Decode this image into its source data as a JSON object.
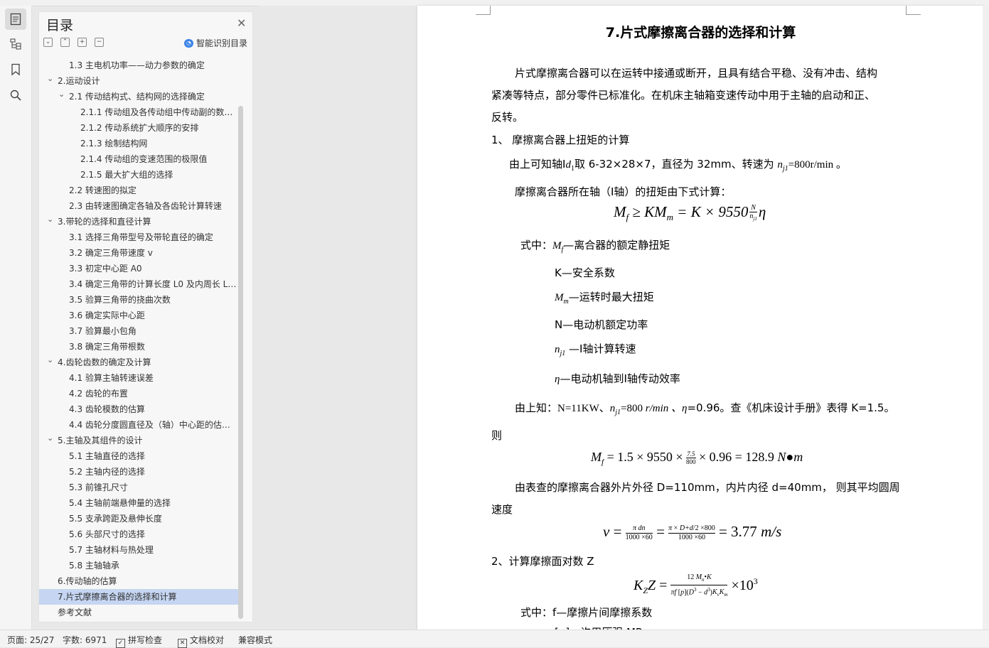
{
  "sidebar": {
    "title": "目录",
    "smart_label": "智能识别目录",
    "toc": [
      {
        "label": "1.3 主电机功率——动力参数的确定",
        "level": 2,
        "chev": ""
      },
      {
        "label": "2.运动设计",
        "level": 1,
        "chev": "v"
      },
      {
        "label": "2.1 传动结构式、结构网的选择确定",
        "level": 2,
        "chev": "v"
      },
      {
        "label": "2.1.1 传动组及各传动组中传动副的数…",
        "level": 3,
        "chev": ""
      },
      {
        "label": "2.1.2  传动系统扩大顺序的安排",
        "level": 3,
        "chev": ""
      },
      {
        "label": "2.1.3  绘制结构网",
        "level": 3,
        "chev": ""
      },
      {
        "label": "2.1.4  传动组的变速范围的极限值",
        "level": 3,
        "chev": ""
      },
      {
        "label": "2.1.5 最大扩大组的选择",
        "level": 3,
        "chev": ""
      },
      {
        "label": "2.2 转速图的拟定",
        "level": 2,
        "chev": ""
      },
      {
        "label": "2.3  由转速图确定各轴及各齿轮计算转速",
        "level": 2,
        "chev": ""
      },
      {
        "label": "3.带轮的选择和直径计算",
        "level": 1,
        "chev": "v"
      },
      {
        "label": "3.1 选择三角带型号及带轮直径的确定",
        "level": 2,
        "chev": ""
      },
      {
        "label": "3.2 确定三角带速度 v",
        "level": 2,
        "chev": ""
      },
      {
        "label": "3.3 初定中心距 A0",
        "level": 2,
        "chev": ""
      },
      {
        "label": "3.4 确定三角带的计算长度 L0 及内周长 L…",
        "level": 2,
        "chev": ""
      },
      {
        "label": "3.5 验算三角带的挠曲次数",
        "level": 2,
        "chev": ""
      },
      {
        "label": "3.6 确定实际中心距",
        "level": 2,
        "chev": ""
      },
      {
        "label": "3.7 验算最小包角",
        "level": 2,
        "chev": ""
      },
      {
        "label": "3.8 确定三角带根数",
        "level": 2,
        "chev": ""
      },
      {
        "label": "4.齿轮齿数的确定及计算",
        "level": 1,
        "chev": "v"
      },
      {
        "label": "4.1 验算主轴转速误差",
        "level": 2,
        "chev": ""
      },
      {
        "label": "4.2 齿轮的布置",
        "level": 2,
        "chev": ""
      },
      {
        "label": "4.3  齿轮模数的估算",
        "level": 2,
        "chev": ""
      },
      {
        "label": "4.4  齿轮分度圆直径及（轴）中心距的估…",
        "level": 2,
        "chev": ""
      },
      {
        "label": "5.主轴及其组件的设计",
        "level": 1,
        "chev": "v"
      },
      {
        "label": "5.1 主轴直径的选择",
        "level": 2,
        "chev": ""
      },
      {
        "label": "5.2 主轴内径的选择",
        "level": 2,
        "chev": ""
      },
      {
        "label": "5.3 前锥孔尺寸",
        "level": 2,
        "chev": ""
      },
      {
        "label": "5.4 主轴前端悬伸量的选择",
        "level": 2,
        "chev": ""
      },
      {
        "label": "5.5 支承跨距及悬伸长度",
        "level": 2,
        "chev": ""
      },
      {
        "label": "5.6 头部尺寸的选择",
        "level": 2,
        "chev": ""
      },
      {
        "label": "5.7 主轴材料与热处理",
        "level": 2,
        "chev": ""
      },
      {
        "label": "5.8 主轴轴承",
        "level": 2,
        "chev": ""
      },
      {
        "label": "6.传动轴的估算",
        "level": 1,
        "chev": ""
      },
      {
        "label": "7.片式摩擦离合器的选择和计算",
        "level": 1,
        "chev": "",
        "selected": true
      },
      {
        "label": "参考文献",
        "level": 1,
        "chev": ""
      }
    ]
  },
  "document": {
    "title": "7.片式摩擦离合器的选择和计算",
    "p1a": "片式摩擦离合器可以在运转中接通或断开，且具有结合平稳、没有冲击、结构",
    "p1b": "紧凑等特点，部分零件已标准化。在机床主轴箱变速传动中用于主轴的启动和正、",
    "p1c": "反转。",
    "h1": "1、  摩擦离合器上扭矩的计算",
    "line_a1": "由上可知轴Ⅰ",
    "line_a2": "取    6-32×28×7，直径为 32mm、转速为",
    "line_a3": "=800",
    "line_a4": "r/min  。",
    "line_b": "摩擦离合器所在轴（Ⅰ轴）的扭矩由下式计算：",
    "formula1": "M_f ≥ KM_m = K × 9550 N/n_j1 η",
    "where1_label": "式中：",
    "where1_text": "—离合器的额定静扭矩",
    "where_k": "K—安全系数",
    "where_mm": "—运转时最大扭矩",
    "where_n": "N—电动机额定功率",
    "where_nj": " —Ⅰ轴计算转速",
    "where_eta": "—电动机轴到Ⅰ轴传动效率",
    "given1": "由上知：N=11KW、",
    "given2": "=800",
    "given3": " r/min  、",
    "given4": "=0.96。查《机床设计手册》表得  K=1.5。",
    "then": "则",
    "formula2": "M_f = 1.5 × 9550 × 7.5/800 × 0.96 = 128.9 N·m",
    "p2a": "由表查的摩擦离合器外片外径 D=110mm，内片内径 d=40mm，  则其平均圆周",
    "p2b": "速度",
    "formula3": "v = πdn/(1000×60) = π×(D+d)/2×800/(1000×60) = 3.77 m/s",
    "h2": "2、计算摩擦面对数 Z",
    "formula4": "K_Z Z = 12 M_n·K / (πf[p](D^3 − d^3)K_v K_m) × 10^3",
    "where2": "式中：f—摩擦片间摩擦系数",
    "cut_line": "[p]—许用压强 MPa"
  },
  "statusbar": {
    "page": "页面: 25/27",
    "words": "字数: 6971",
    "spell": "拼写检查",
    "proof": "文档校对",
    "compat": "兼容模式"
  }
}
